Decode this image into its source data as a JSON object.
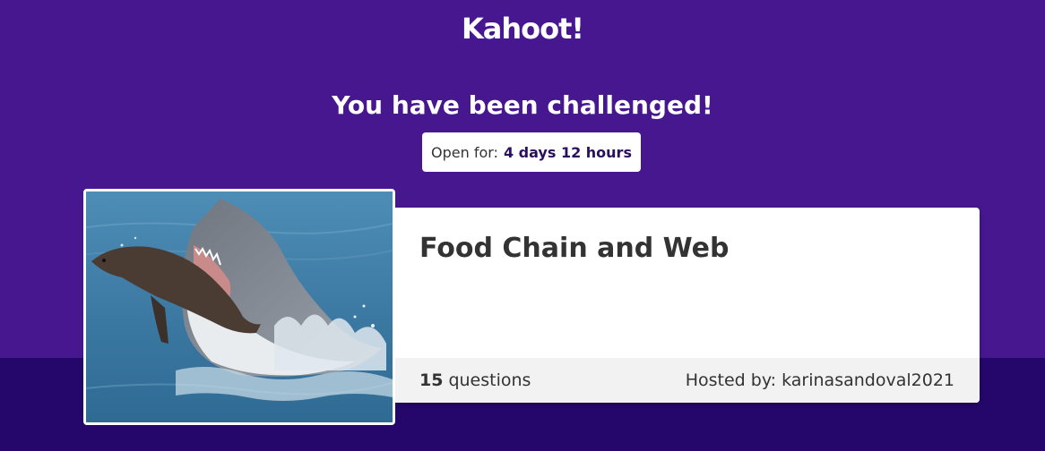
{
  "header": {
    "logo_text": "Kahoot!"
  },
  "challenge": {
    "headline": "You have been challenged!",
    "open_for_label": "Open for:",
    "open_for_value": "4 days 12 hours"
  },
  "kahoot": {
    "title": "Food Chain and Web",
    "question_count": "15",
    "question_label": "questions",
    "hosted_by": "Hosted by: karinasandoval2021",
    "cover_image": "shark-attacking-seal-photo"
  },
  "colors": {
    "brand_purple": "#46178f",
    "dark_purple_band": "#25076b",
    "card_background": "#ffffff",
    "footer_background": "#f2f2f2"
  }
}
